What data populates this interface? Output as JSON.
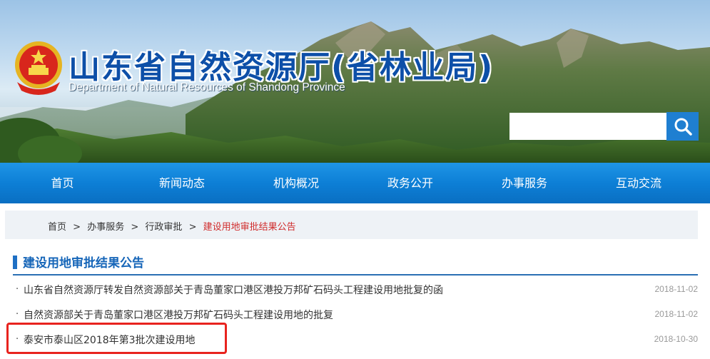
{
  "header": {
    "title": "山东省自然资源厅(省林业局)",
    "subtitle": "Department of Natural Resources of Shandong Province",
    "search": {
      "placeholder": "",
      "button_icon": "search-icon"
    },
    "colors": {
      "title": "#0d4fa8",
      "nav": "#0d7fd6",
      "search_button": "#1f7fd1"
    }
  },
  "nav": {
    "items": [
      {
        "label": "首页"
      },
      {
        "label": "新闻动态"
      },
      {
        "label": "机构概况"
      },
      {
        "label": "政务公开"
      },
      {
        "label": "办事服务"
      },
      {
        "label": "互动交流"
      }
    ]
  },
  "breadcrumb": {
    "items": [
      "首页",
      "办事服务",
      "行政审批"
    ],
    "separator": ">",
    "current": "建设用地审批结果公告"
  },
  "section": {
    "title": "建设用地审批结果公告",
    "bullet": "·",
    "list": [
      {
        "title": "山东省自然资源厅转发自然资源部关于青岛董家口港区港投万邦矿石码头工程建设用地批复的函",
        "date": "2018-11-02"
      },
      {
        "title": "自然资源部关于青岛董家口港区港投万邦矿石码头工程建设用地的批复",
        "date": "2018-11-02"
      },
      {
        "title": "泰安市泰山区2018年第3批次建设用地",
        "date": "2018-10-30"
      }
    ],
    "highlight_color": "#e8231e"
  }
}
